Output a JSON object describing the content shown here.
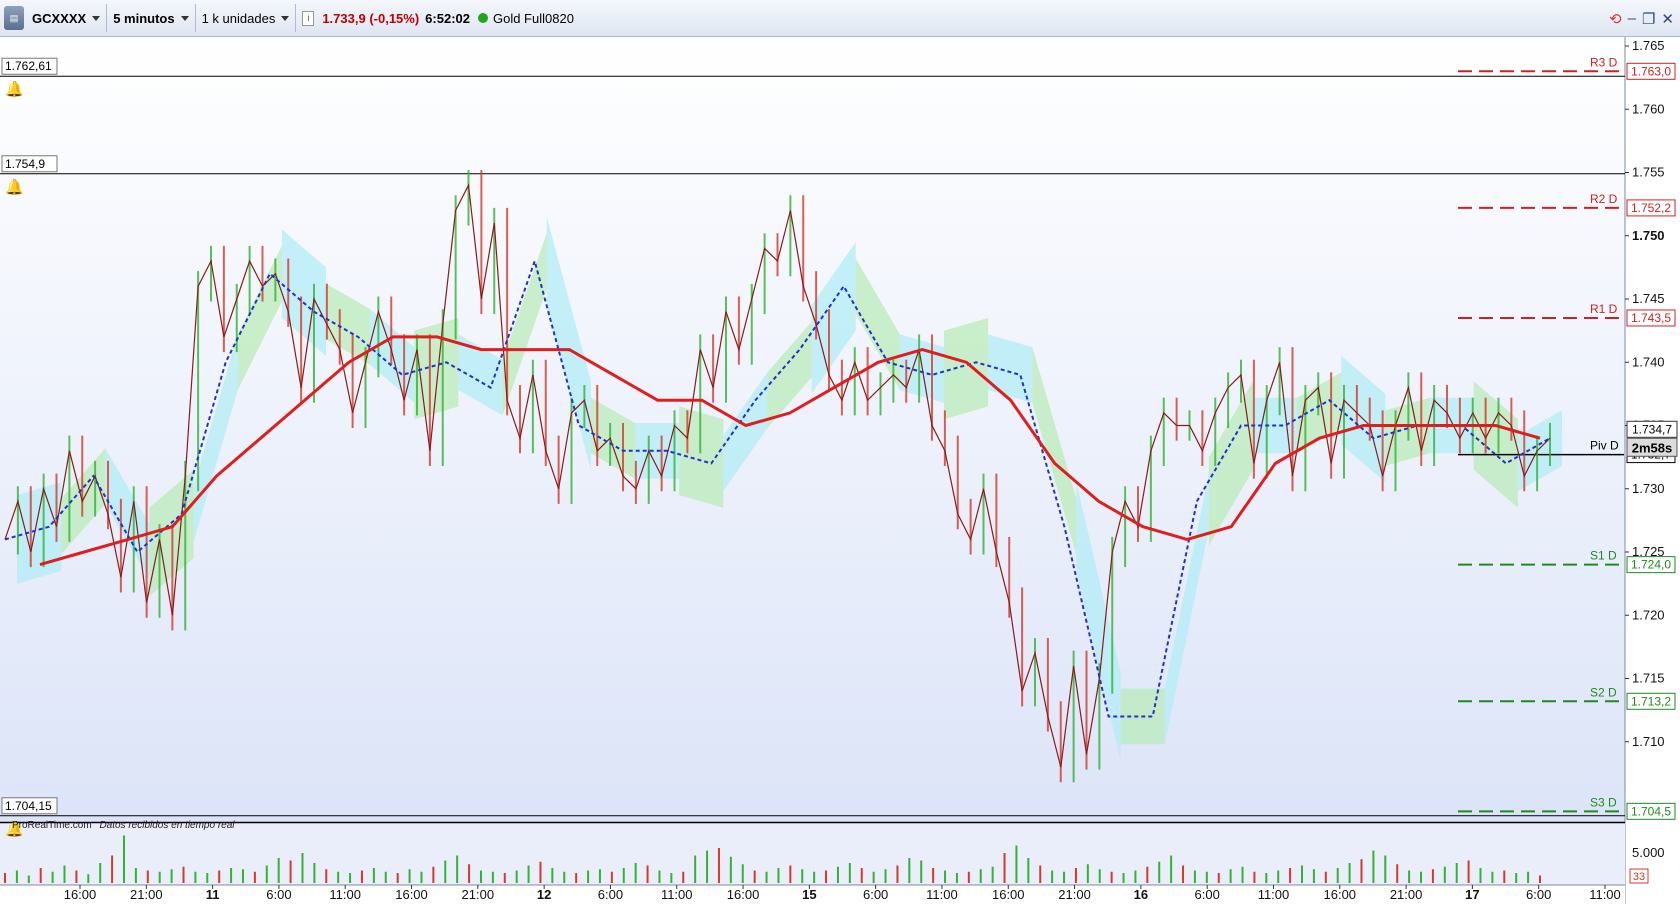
{
  "toolbar": {
    "instrument": "GCXXXX",
    "timeframe": "5 minutos",
    "units": "1 k unidades",
    "price_change": "1.733,9 (-0,15%)",
    "time": "6:52:02",
    "feed_name": "Gold Full0820",
    "status_color": "#22a51a"
  },
  "chart_data": {
    "type": "line",
    "instrument": "GCXXXX",
    "timeframe": "5 minutos",
    "ylim": [
      1705.5,
      1766
    ],
    "y_ticks": [
      "1.765",
      "1.760",
      "1.755",
      "1.750",
      "1.745",
      "1.740",
      "1.735",
      "1.730",
      "1.725",
      "1.720",
      "1.715",
      "1.710"
    ],
    "x_tick_labels": [
      {
        "label": "16:00",
        "bold": false
      },
      {
        "label": "21:00",
        "bold": false
      },
      {
        "label": "11",
        "bold": true
      },
      {
        "label": "6:00",
        "bold": false
      },
      {
        "label": "11:00",
        "bold": false
      },
      {
        "label": "16:00",
        "bold": false
      },
      {
        "label": "21:00",
        "bold": false
      },
      {
        "label": "12",
        "bold": true
      },
      {
        "label": "6:00",
        "bold": false
      },
      {
        "label": "11:00",
        "bold": false
      },
      {
        "label": "16:00",
        "bold": false
      },
      {
        "label": "15",
        "bold": true
      },
      {
        "label": "6:00",
        "bold": false
      },
      {
        "label": "11:00",
        "bold": false
      },
      {
        "label": "16:00",
        "bold": false
      },
      {
        "label": "21:00",
        "bold": false
      },
      {
        "label": "16",
        "bold": true
      },
      {
        "label": "6:00",
        "bold": false
      },
      {
        "label": "11:00",
        "bold": false
      },
      {
        "label": "16:00",
        "bold": false
      },
      {
        "label": "21:00",
        "bold": false
      },
      {
        "label": "17",
        "bold": true
      },
      {
        "label": "6:00",
        "bold": false
      },
      {
        "label": "11:00",
        "bold": false
      }
    ],
    "price_series": {
      "name": "Price",
      "color": "#8b1a1a",
      "values": [
        1726,
        1729,
        1725,
        1730,
        1727,
        1733,
        1729,
        1731,
        1728,
        1723,
        1729,
        1721,
        1726,
        1720,
        1731,
        1746,
        1748,
        1742,
        1745,
        1748,
        1746,
        1747,
        1744,
        1738,
        1745,
        1743,
        1741,
        1736,
        1740,
        1744,
        1741,
        1737,
        1741,
        1733,
        1743,
        1752,
        1754,
        1745,
        1751,
        1737,
        1734,
        1739,
        1733,
        1730,
        1736,
        1737,
        1733,
        1734,
        1731,
        1730,
        1733,
        1731,
        1735,
        1734,
        1741,
        1738,
        1744,
        1741,
        1745,
        1749,
        1748,
        1752,
        1746,
        1743,
        1739,
        1737,
        1740,
        1737,
        1738,
        1739,
        1738,
        1741,
        1735,
        1733,
        1728,
        1726,
        1730,
        1725,
        1721,
        1714,
        1717,
        1712,
        1708,
        1716,
        1709,
        1715,
        1725,
        1729,
        1727,
        1733,
        1736,
        1735,
        1735,
        1733,
        1736,
        1738,
        1739,
        1732,
        1737,
        1740,
        1731,
        1737,
        1738,
        1732,
        1737,
        1736,
        1735,
        1731,
        1735,
        1738,
        1733,
        1737,
        1736,
        1734,
        1736,
        1734,
        1736,
        1735,
        1731,
        1733,
        1734
      ]
    },
    "trend_line": {
      "name": "Moving average",
      "color": "#dd1f1f",
      "values": [
        1724,
        1725,
        1726,
        1727,
        1731,
        1734,
        1737,
        1740,
        1742,
        1742,
        1741,
        1741,
        1741,
        1739,
        1737,
        1737,
        1735,
        1736,
        1738,
        1740,
        1741,
        1740,
        1737,
        1732,
        1729,
        1727,
        1726,
        1727,
        1732,
        1734,
        1735,
        1735,
        1735,
        1735,
        1734
      ]
    },
    "tenkan_line": {
      "name": "Dashed line",
      "color": "#2231c8",
      "values": [
        1726,
        1727,
        1731,
        1725,
        1728,
        1740,
        1747,
        1744,
        1742,
        1739,
        1740,
        1738,
        1748,
        1735,
        1733,
        1733,
        1732,
        1737,
        1741,
        1746,
        1740,
        1739,
        1740,
        1739,
        1727,
        1712,
        1712,
        1729,
        1735,
        1735,
        1737,
        1734,
        1735,
        1735,
        1732,
        1734
      ]
    },
    "pivot_levels": [
      {
        "name": "R3 D",
        "value": 1763.0,
        "label": "1.763,0",
        "color": "#cc2222"
      },
      {
        "name": "R2 D",
        "value": 1752.2,
        "label": "1.752,2",
        "color": "#cc2222"
      },
      {
        "name": "R1 D",
        "value": 1743.5,
        "label": "1.743,5",
        "color": "#cc2222"
      },
      {
        "name": "Piv D",
        "value": 1732.7,
        "label": "1.732,7",
        "color": "#000000"
      },
      {
        "name": "S1 D",
        "value": 1724.0,
        "label": "1.724,0",
        "color": "#1e8a1e"
      },
      {
        "name": "S2 D",
        "value": 1713.2,
        "label": "1.713,2",
        "color": "#1e8a1e"
      },
      {
        "name": "S3 D",
        "value": 1704.5,
        "label": "1.704,5",
        "color": "#1e8a1e"
      }
    ],
    "alert_lines": [
      {
        "value": 1762.61,
        "label": "1.762,61"
      },
      {
        "value": 1754.9,
        "label": "1.754,9"
      },
      {
        "value": 1704.15,
        "label": "1.704,15"
      }
    ],
    "current_price_label": "1.734,7",
    "countdown_label": "2m58s",
    "highlight_tick": "1.750",
    "footer_text": "ProRealTime.com",
    "footer_note": "Datos recibidos en tiempo real",
    "volume": {
      "tick_label": "5.000",
      "last_value_label": "33",
      "values": [
        8,
        10,
        6,
        12,
        9,
        14,
        10,
        7,
        16,
        22,
        38,
        12,
        10,
        9,
        11,
        13,
        9,
        8,
        10,
        12,
        11,
        9,
        14,
        20,
        18,
        24,
        16,
        11,
        9,
        8,
        10,
        12,
        9,
        8,
        11,
        9,
        13,
        18,
        22,
        15,
        10,
        9,
        8,
        10,
        14,
        17,
        12,
        9,
        8,
        10,
        11,
        9,
        12,
        16,
        14,
        10,
        8,
        9,
        22,
        26,
        28,
        21,
        15,
        10,
        9,
        12,
        14,
        11,
        9,
        10,
        13,
        16,
        12,
        9,
        11,
        14,
        20,
        18,
        12,
        10,
        8,
        9,
        11,
        13,
        24,
        30,
        20,
        14,
        10,
        9,
        12,
        15,
        11,
        9,
        8,
        10,
        13,
        17,
        22,
        14,
        10,
        9,
        8,
        11,
        13,
        9,
        8,
        10,
        12,
        14,
        11,
        9,
        12,
        16,
        19,
        26,
        22,
        15,
        10,
        9,
        11,
        13,
        16,
        18,
        12,
        9,
        10,
        8,
        9,
        6
      ]
    },
    "colors": {
      "background_top": "#ffffff",
      "background_bottom": "#dce4f8",
      "cloud_green": "#b9ebb9",
      "cloud_cyan": "#b2ecf6",
      "candle_green": "#33b233",
      "candle_red": "#d23a2a"
    }
  }
}
